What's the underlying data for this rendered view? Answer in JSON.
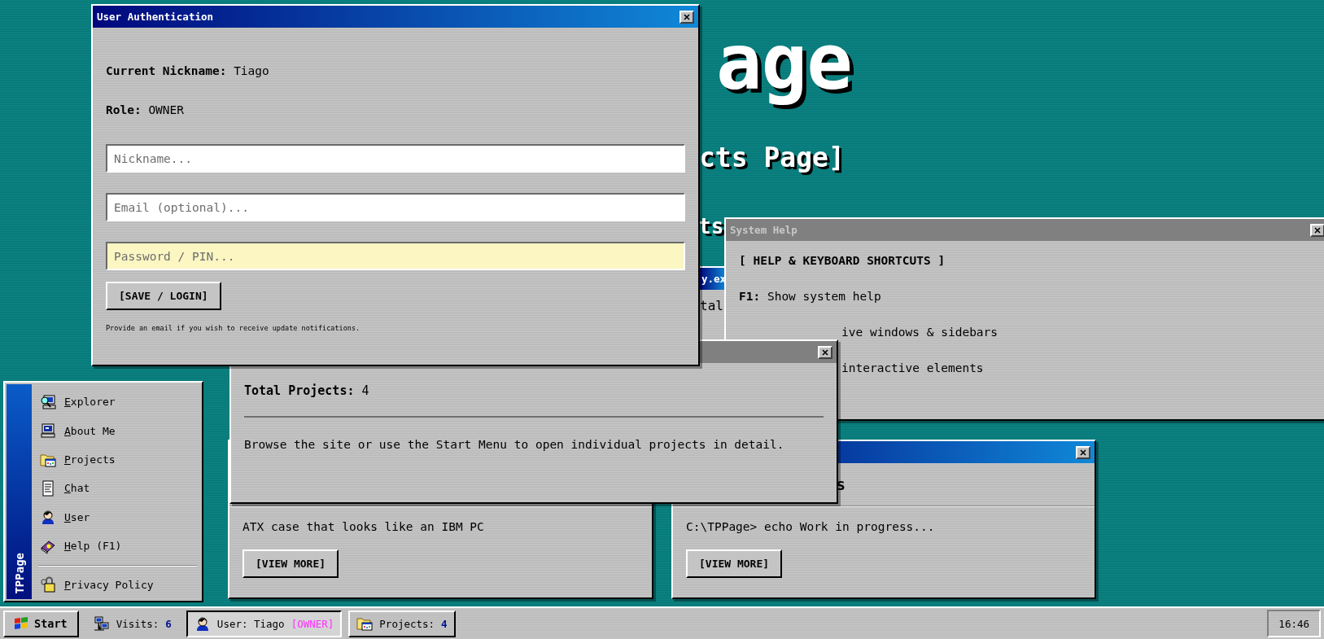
{
  "desktop_text": [
    {
      "kind": "title",
      "text": "age"
    },
    {
      "kind": "subtitle",
      "text": "cts Page]"
    },
    {
      "kind": "section",
      "text": "ts"
    }
  ],
  "background_window": {
    "title": "y.ex",
    "text": "tal"
  },
  "project_cards": [
    {
      "description": "ATX case that looks like an IBM PC",
      "button": "[VIEW MORE]"
    },
    {
      "active": true,
      "heading": "s",
      "description": "C:\\TPPage> echo Work in progress...",
      "button": "[VIEW MORE]"
    }
  ],
  "help_window": {
    "title": "System Help",
    "active": false,
    "heading": "[ HELP & KEYBOARD SHORTCUTS ]",
    "lines": [
      {
        "kind": "full",
        "text": "**F1:** Show system help"
      },
      {
        "kind": "fragment",
        "text": "ive windows & sidebars"
      },
      {
        "kind": "fragment",
        "text": "interactive elements"
      }
    ]
  },
  "projects_window": {
    "active": false,
    "summary": "**Total Projects:** 4",
    "text": "Browse the site or use the Start Menu to open individual projects in detail."
  },
  "auth_window": {
    "title": "User Authentication",
    "active": true,
    "info": [
      "**Current Nickname:** Tiago",
      "**Role:** OWNER"
    ],
    "fields": [
      {
        "placeholder": "Nickname...",
        "kind": "text"
      },
      {
        "placeholder": "Email (optional)...",
        "kind": "text"
      },
      {
        "placeholder": "Password / PIN...",
        "kind": "password"
      }
    ],
    "button": "[SAVE / LOGIN]",
    "note": "Provide an email if you wish to receive update notifications."
  },
  "start_menu": {
    "brand": "TPPage",
    "items": [
      {
        "kind": "explorer",
        "label": "Explorer"
      },
      {
        "kind": "computer",
        "label": "About Me"
      },
      {
        "kind": "folder",
        "label": "Projects"
      },
      {
        "kind": "document",
        "label": "Chat"
      },
      {
        "kind": "user",
        "label": "User"
      },
      {
        "kind": "book",
        "label": "Help (F1)"
      }
    ],
    "footer_items": [
      {
        "kind": "lock",
        "label": "Privacy Policy"
      }
    ]
  },
  "taskbar": {
    "start": "Start",
    "items": [
      {
        "kind": "network",
        "boxed": false,
        "label": "Visits:",
        "value": "6",
        "selected": false
      },
      {
        "kind": "user",
        "boxed": true,
        "label": "User: Tiago",
        "badge": "[OWNER]",
        "selected": true
      },
      {
        "kind": "folder",
        "boxed": true,
        "label": "Projects:",
        "value": "4",
        "selected": false
      }
    ],
    "clock": "16:46"
  }
}
